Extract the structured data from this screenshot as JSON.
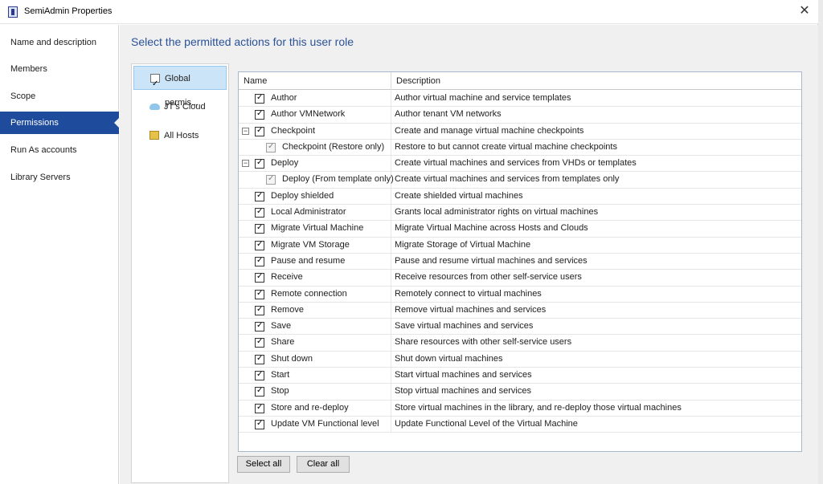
{
  "window": {
    "title": "SemiAdmin Properties",
    "close_glyph": "✕"
  },
  "nav": {
    "items": [
      {
        "label": "Name and description"
      },
      {
        "label": "Members"
      },
      {
        "label": "Scope"
      },
      {
        "label": "Permissions",
        "selected": true
      },
      {
        "label": "Run As accounts"
      },
      {
        "label": "Library Servers"
      }
    ]
  },
  "heading": "Select the permitted actions for this user role",
  "scopes": [
    {
      "label": "Global permis...",
      "icon": "checkbox-icon",
      "selected": true
    },
    {
      "label": "JT's Cloud",
      "icon": "cloud-icon"
    },
    {
      "label": "All Hosts",
      "icon": "hosts-icon"
    }
  ],
  "grid": {
    "columns": {
      "name": "Name",
      "description": "Description"
    },
    "rows": [
      {
        "name": "Author",
        "description": "Author virtual machine and service templates",
        "level": 0,
        "expander": false,
        "checked": true
      },
      {
        "name": "Author VMNetwork",
        "description": "Author tenant VM networks",
        "level": 0,
        "expander": false,
        "checked": true
      },
      {
        "name": "Checkpoint",
        "description": "Create and manage virtual machine checkpoints",
        "level": 0,
        "expander": true,
        "checked": true
      },
      {
        "name": "Checkpoint (Restore only)",
        "description": "Restore to but cannot create virtual machine checkpoints",
        "level": 1,
        "expander": false,
        "checked": true
      },
      {
        "name": "Deploy",
        "description": "Create virtual machines and services from VHDs or templates",
        "level": 0,
        "expander": true,
        "checked": true
      },
      {
        "name": "Deploy (From template only)",
        "description": "Create virtual machines and services from templates only",
        "level": 1,
        "expander": false,
        "checked": true
      },
      {
        "name": "Deploy shielded",
        "description": "Create shielded virtual machines",
        "level": 0,
        "expander": false,
        "checked": true
      },
      {
        "name": "Local Administrator",
        "description": "Grants local administrator rights on virtual machines",
        "level": 0,
        "expander": false,
        "checked": true
      },
      {
        "name": "Migrate Virtual Machine",
        "description": "Migrate Virtual Machine across Hosts and Clouds",
        "level": 0,
        "expander": false,
        "checked": true
      },
      {
        "name": "Migrate VM Storage",
        "description": "Migrate Storage of Virtual Machine",
        "level": 0,
        "expander": false,
        "checked": true
      },
      {
        "name": "Pause and resume",
        "description": "Pause and resume virtual machines and services",
        "level": 0,
        "expander": false,
        "checked": true
      },
      {
        "name": "Receive",
        "description": "Receive resources from other self-service users",
        "level": 0,
        "expander": false,
        "checked": true
      },
      {
        "name": "Remote connection",
        "description": "Remotely connect to virtual machines",
        "level": 0,
        "expander": false,
        "checked": true
      },
      {
        "name": "Remove",
        "description": "Remove virtual machines and services",
        "level": 0,
        "expander": false,
        "checked": true
      },
      {
        "name": "Save",
        "description": "Save virtual machines and services",
        "level": 0,
        "expander": false,
        "checked": true
      },
      {
        "name": "Share",
        "description": "Share resources with other self-service users",
        "level": 0,
        "expander": false,
        "checked": true
      },
      {
        "name": "Shut down",
        "description": "Shut down virtual machines",
        "level": 0,
        "expander": false,
        "checked": true
      },
      {
        "name": "Start",
        "description": "Start virtual machines and services",
        "level": 0,
        "expander": false,
        "checked": true
      },
      {
        "name": "Stop",
        "description": "Stop virtual machines and services",
        "level": 0,
        "expander": false,
        "checked": true
      },
      {
        "name": "Store and re-deploy",
        "description": "Store virtual machines in the library, and re-deploy those virtual machines",
        "level": 0,
        "expander": false,
        "checked": true
      },
      {
        "name": "Update VM Functional level",
        "description": "Update Functional Level of the Virtual Machine",
        "level": 0,
        "expander": false,
        "checked": true
      }
    ]
  },
  "buttons": {
    "select_all": "Select all",
    "clear_all": "Clear all"
  }
}
